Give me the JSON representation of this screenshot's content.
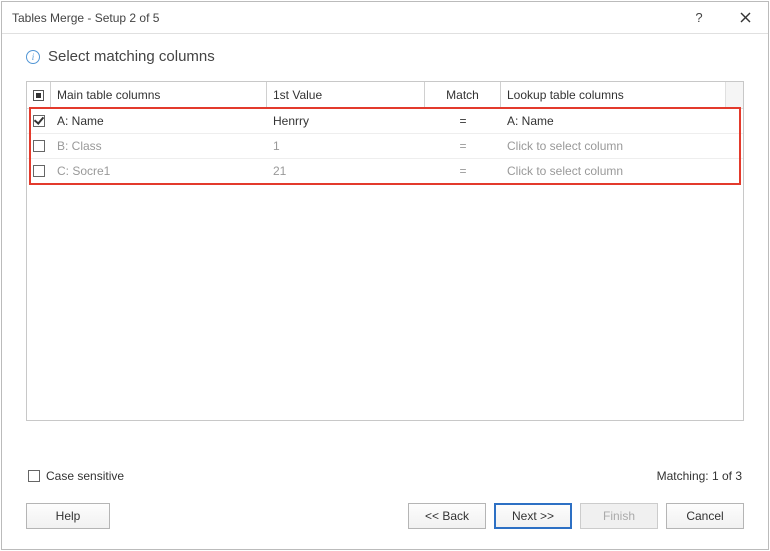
{
  "window": {
    "title": "Tables Merge - Setup 2 of 5"
  },
  "heading": "Select matching columns",
  "table": {
    "headers": {
      "main": "Main table columns",
      "value": "1st Value",
      "match": "Match",
      "lookup": "Lookup table columns"
    },
    "rows": [
      {
        "checked": true,
        "main": "A: Name",
        "value": "Henrry",
        "match": "=",
        "lookup": "A: Name"
      },
      {
        "checked": false,
        "main": "B: Class",
        "value": "1",
        "match": "=",
        "lookup": "Click to select column"
      },
      {
        "checked": false,
        "main": "C: Socre1",
        "value": "21",
        "match": "=",
        "lookup": "Click to select column"
      }
    ]
  },
  "options": {
    "case_sensitive_label": "Case sensitive",
    "matching_label": "Matching: 1 of 3"
  },
  "buttons": {
    "help": "Help",
    "back": "<< Back",
    "next": "Next >>",
    "finish": "Finish",
    "cancel": "Cancel"
  }
}
